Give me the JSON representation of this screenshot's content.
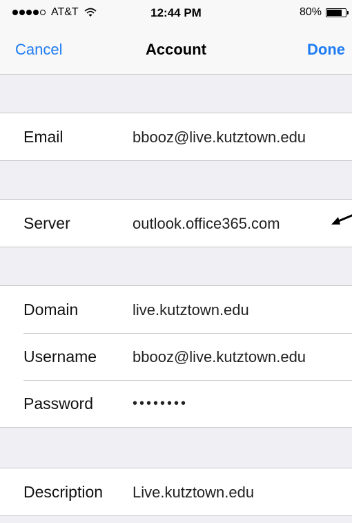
{
  "status": {
    "carrier": "AT&T",
    "time": "12:44 PM",
    "battery": "80%",
    "battery_level": 0.8,
    "signal_bars_filled": 4,
    "signal_bars_total": 5
  },
  "nav": {
    "cancel_label": "Cancel",
    "title": "Account",
    "done_label": "Done",
    "accent_color": "#1e7cf3"
  },
  "fields": {
    "email": {
      "label": "Email",
      "value": "bbooz@live.kutztown.edu"
    },
    "server": {
      "label": "Server",
      "value": "outlook.office365.com"
    },
    "domain": {
      "label": "Domain",
      "value": "live.kutztown.edu"
    },
    "username": {
      "label": "Username",
      "value": "bbooz@live.kutztown.edu"
    },
    "password": {
      "label": "Password",
      "value": "••••••••"
    },
    "description": {
      "label": "Description",
      "value": "Live.kutztown.edu"
    }
  }
}
